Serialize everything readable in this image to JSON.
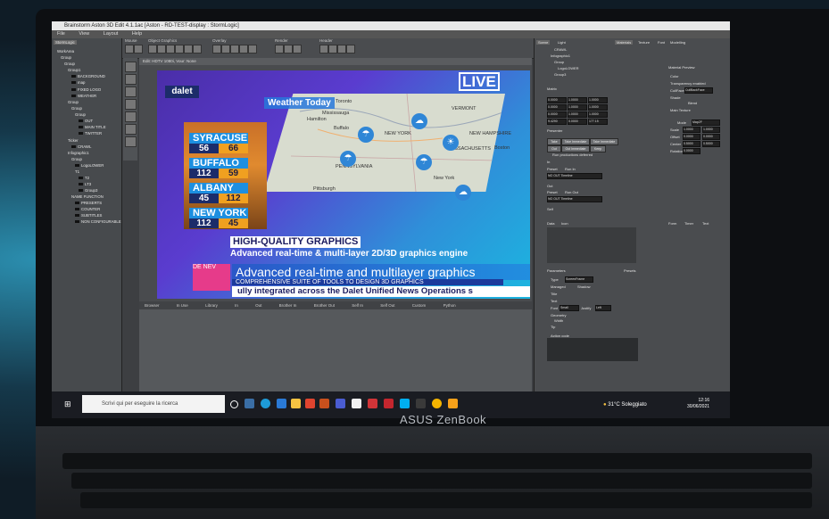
{
  "window": {
    "title": "Brainstorm Aston 3D Edit 4.1.1ac [Aston - RD-TEST-display : StormLogic]"
  },
  "menu": [
    "File",
    "View",
    "Layout",
    "Help"
  ],
  "toolbar_groups": [
    "Mouse",
    "Object Graphics",
    "Overlay",
    "Render",
    "Header"
  ],
  "tree": {
    "root": "StormLogic",
    "items": [
      "WorkArea",
      "Group",
      "Group",
      "Group1",
      "BACKGROUND",
      "map",
      "FIXED LOGO",
      "WEATHER",
      "Group",
      "Group",
      "Group",
      "OUT",
      "MAIN TITLE",
      "TWITTER",
      "Ticker",
      "CRAWL",
      "Infographic1",
      "Group",
      "LogoLOWER",
      "T1",
      "T2",
      "LT3",
      "Group3",
      "NAME FUNCTION",
      "PRESERTS",
      "COUNTER",
      "SUBTITLES",
      "NON CONFIGURABLE"
    ]
  },
  "viewport": {
    "header": "Edit: HDTV 1080i, Vour: None"
  },
  "graphic": {
    "brand": "dalet",
    "live": "LIVE",
    "weather_title": "Weather Today",
    "cities": [
      {
        "name": "SYRACUSE",
        "lo": "56",
        "hi": "66"
      },
      {
        "name": "BUFFALO",
        "lo": "112",
        "hi": "59"
      },
      {
        "name": "ALBANY",
        "lo": "45",
        "hi": "112"
      },
      {
        "name": "NEW YORK",
        "lo": "112",
        "hi": "45"
      }
    ],
    "map_labels": [
      "Toronto",
      "Mississauga",
      "Hamilton",
      "Buffalo",
      "NEW YORK",
      "VERMONT",
      "NEW HAMPSHIRE",
      "MASSACHUSETTS",
      "Boston",
      "PENNSYLVANIA",
      "Pittsburgh",
      "New York"
    ],
    "headline": "HIGH-QUALITY GRAPHICS",
    "subheadline": "Advanced real-time & multi-layer 2D/3D graphics engine",
    "strap_logo": "DE NEV",
    "strap_main": "Advanced real-time and multilayer graphics",
    "strap_sub": "COMPREHENSIVE SUITE OF TOOLS TO DESIGN 3D GRAPHICS",
    "strap_ticker": "ully integrated across the Dalet Unified News Operations s"
  },
  "lower_tabs": [
    "Browser",
    "In Use",
    "Library",
    "In",
    "Out",
    "Brother In",
    "Brother Out",
    "Self In",
    "Self Out",
    "Custom",
    "Python"
  ],
  "right_panel": {
    "tabs": [
      "Scene",
      "Light",
      "Materials",
      "Texture",
      "Font",
      "Modelling"
    ],
    "tree_items": [
      "CRAWL",
      "Infographic1",
      "Group",
      "LogoLOWER",
      "Group3"
    ],
    "matrix_label": "Matrix",
    "matrix_values": [
      "0.0000",
      "1.0000",
      "1.0000",
      "0.0000",
      "1.0000",
      "1.0000",
      "0.0000",
      "1.0000",
      "1.0000",
      "9.4290",
      "0.0000",
      "177.15"
    ],
    "presenter_label": "Presenter",
    "presenter_buttons": [
      "Take",
      "Take Immediate",
      "Take Immediate",
      "Out",
      "Out Immediate",
      "Keep"
    ],
    "run_label": "Run productions deferred",
    "in_label": "In",
    "out_label": "Out",
    "preset_labels": [
      "Preset",
      "Run In",
      "Preset",
      "Run Out"
    ],
    "preset_values": [
      "NO OUT Timeline",
      "NO OUT Timeline"
    ],
    "self_label": "Self",
    "data_labels": [
      "Data",
      "Icon"
    ],
    "parameters_label": "Parameters",
    "presets_label": "Presets",
    "params": [
      "Type",
      "Managed",
      "Shadow",
      "Title",
      "Text",
      "Font",
      "Small",
      "Justify",
      "Left",
      "Geometry",
      "Width",
      "Tip",
      "Action code"
    ],
    "type_value": "ScreenFrame",
    "materials": [
      "Material Preview",
      "Color",
      "Transparency enabled",
      "CullFace",
      "CullBackFace",
      "Shade",
      "Blend",
      "Main Texture",
      "Mode",
      "Map2F",
      "Scale",
      "Offset",
      "Center",
      "Rotation"
    ],
    "mat_values": [
      "1.0000",
      "1.0000",
      "0.0000",
      "0.0000",
      "0.5000",
      "0.5000",
      "0.0000",
      "0.0000",
      "1.0000",
      "1.0000"
    ],
    "lower_tabs": [
      "Form",
      "Timer",
      "Text"
    ]
  },
  "taskbar": {
    "search_placeholder": "Scrivi qui per eseguire la ricerca",
    "weather": "31°C Soleggiato",
    "time": "12:16",
    "date": "30/06/2021"
  },
  "laptop_brand": "ASUS ZenBook",
  "colors": {
    "accent": "#1d8fe0",
    "hi_temp": "#f0a020",
    "lo_temp": "#1c2c6a",
    "strap_pink": "#e63b8a"
  }
}
